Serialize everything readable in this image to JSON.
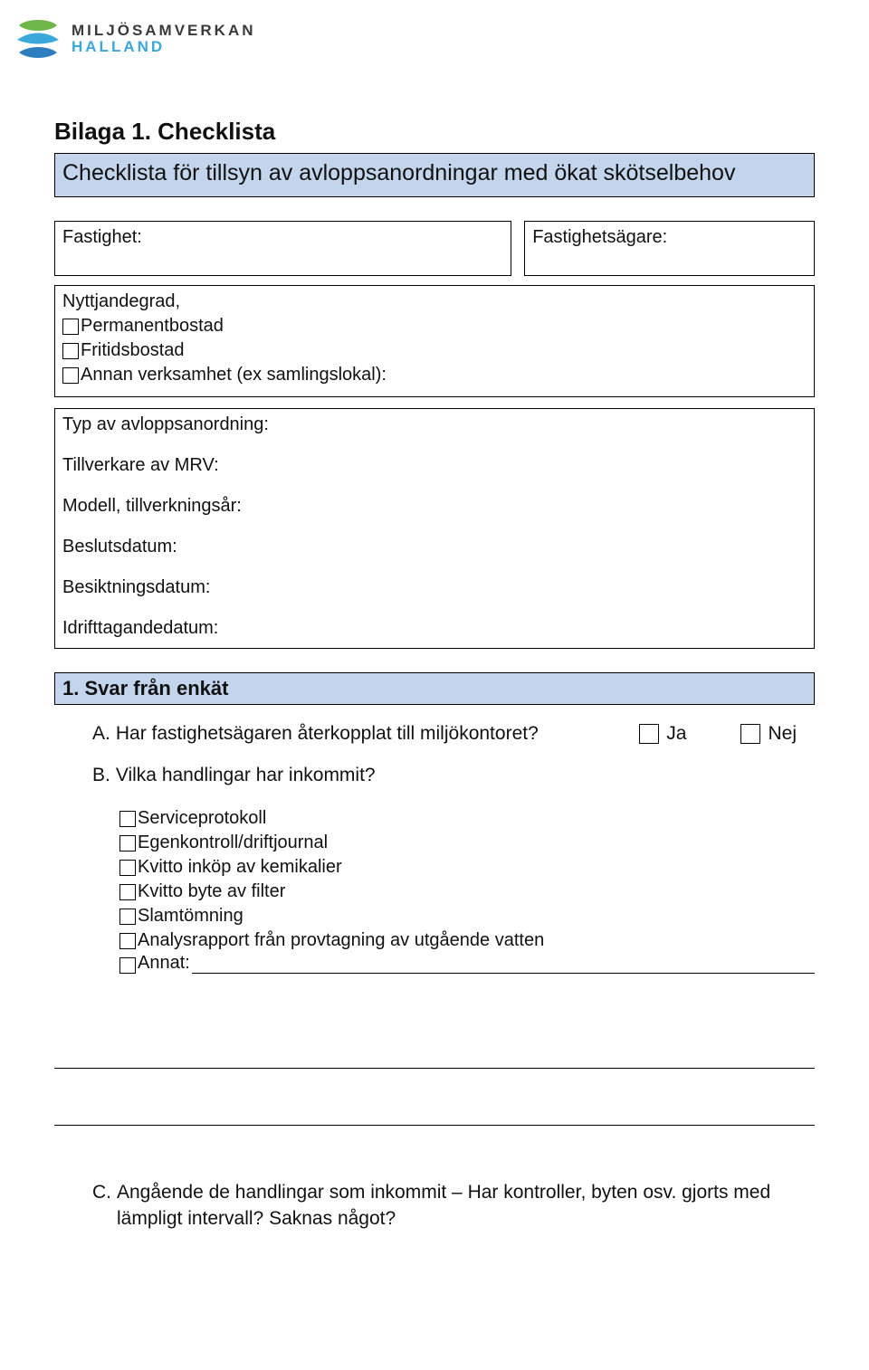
{
  "logo": {
    "top": "MILJÖSAMVERKAN",
    "bottom": "HALLAND"
  },
  "page_title": "Bilaga 1. Checklista",
  "title_box": "Checklista för tillsyn av avloppsanordningar med ökat skötselbehov",
  "fastighet_label": "Fastighet:",
  "fastighetsagare_label": "Fastighetsägare:",
  "nyttjande_label": "Nyttjandegrad,",
  "nyttjande_opts": {
    "permanent": "Permanentbostad",
    "fritid": "Fritidsbostad",
    "annan": "Annan verksamhet (ex samlingslokal):"
  },
  "details": {
    "typ": "Typ av avloppsanordning:",
    "tillverkare": "Tillverkare av MRV:",
    "modell": "Modell, tillverkningsår:",
    "beslut": "Beslutsdatum:",
    "besiktning": "Besiktningsdatum:",
    "idrift": "Idrifttagandedatum:"
  },
  "section1": {
    "header": "1. Svar från enkät",
    "qA": {
      "letter": "A.",
      "text": "Har fastighetsägaren återkopplat till miljökontoret?",
      "yes": "Ja",
      "no": "Nej"
    },
    "qB": {
      "letter": "B.",
      "text": "Vilka handlingar har inkommit?"
    },
    "qB_opts": {
      "serviceprotokoll": "Serviceprotokoll",
      "egenkontroll": "Egenkontroll/driftjournal",
      "kvitto_kemi": "Kvitto inköp av kemikalier",
      "kvitto_filter": "Kvitto byte av filter",
      "slamtomning": "Slamtömning",
      "analysrapport": "Analysrapport från provtagning av utgående vatten",
      "annat": "Annat:"
    },
    "qC": {
      "letter": "C.",
      "text": "Angående de handlingar som inkommit – Har kontroller, byten osv. gjorts med lämpligt intervall? Saknas något?"
    }
  }
}
